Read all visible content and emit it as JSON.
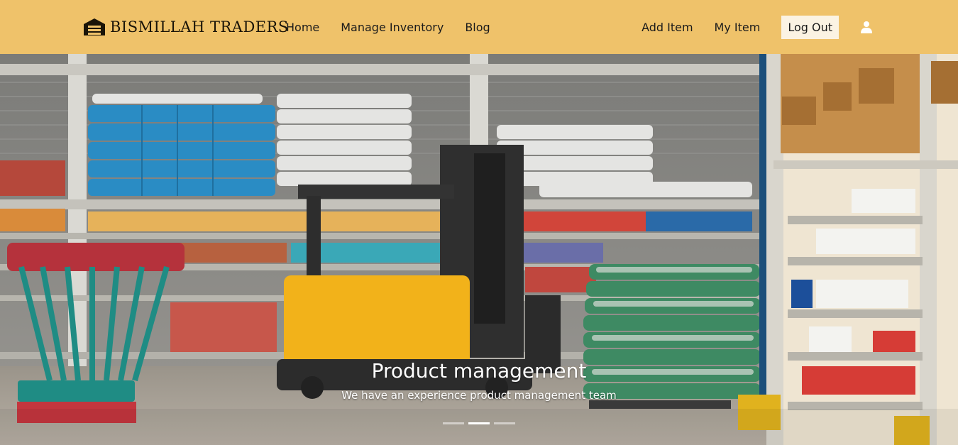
{
  "navbar": {
    "brand": "BISMILLAH TRADERS",
    "brand_icon": "warehouse-icon",
    "left_links": [
      {
        "label": "Home"
      },
      {
        "label": "Manage Inventory"
      },
      {
        "label": "Blog"
      }
    ],
    "right_links": [
      {
        "label": "Add Item"
      },
      {
        "label": "My Item"
      }
    ],
    "logout_label": "Log Out",
    "user_icon": "user-icon",
    "bg_color": "#efc26a"
  },
  "hero": {
    "title": "Product management",
    "subtitle": "We have an experience product management team",
    "slides_total": 3,
    "active_slide": 2
  }
}
